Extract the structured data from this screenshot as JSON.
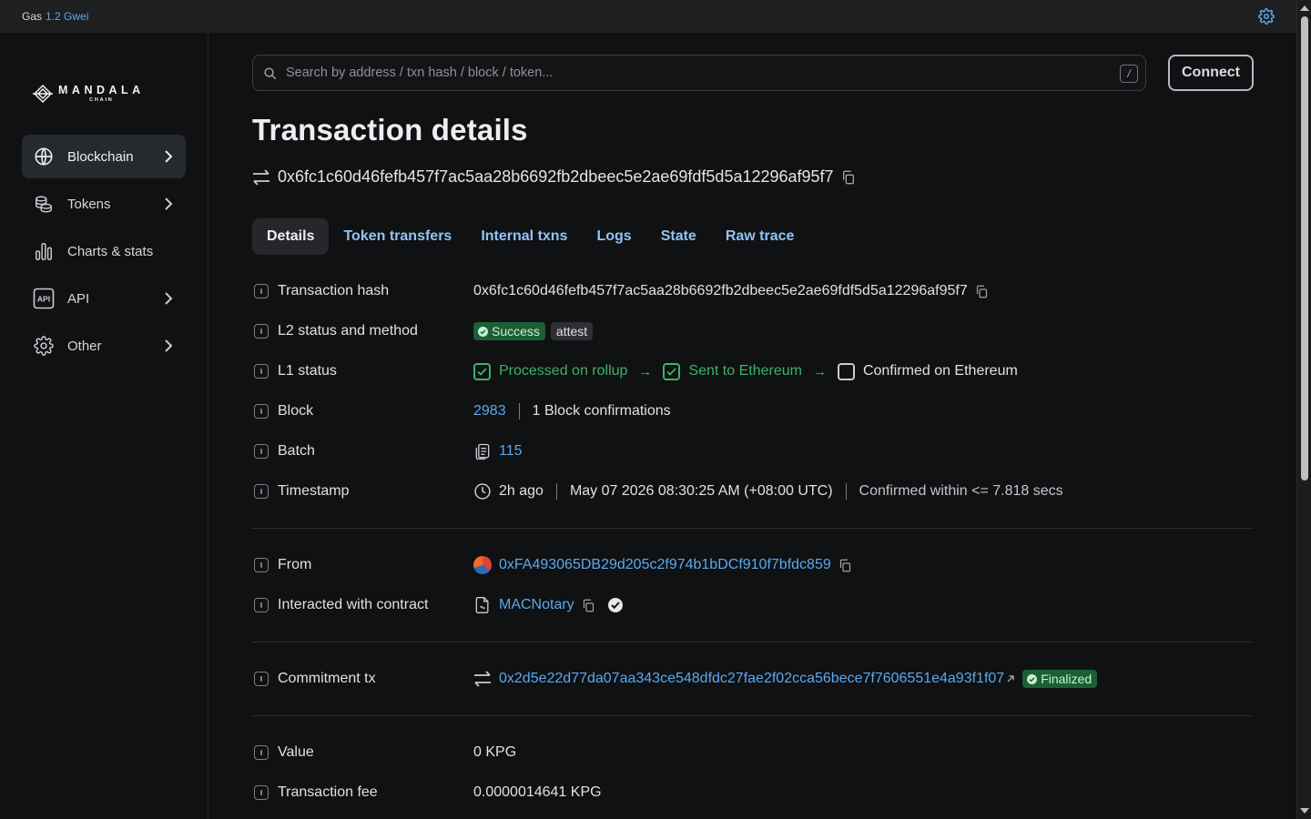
{
  "topbar": {
    "gas_label": "Gas",
    "gas_value": "1.2 Gwei"
  },
  "sidebar": {
    "logo_main": "MANDALA",
    "logo_sub": "CHAIN",
    "items": [
      {
        "label": "Blockchain",
        "icon": "globe-icon",
        "active": true,
        "has_chevron": true
      },
      {
        "label": "Tokens",
        "icon": "coins-icon",
        "active": false,
        "has_chevron": true
      },
      {
        "label": "Charts & stats",
        "icon": "bar-chart-icon",
        "active": false,
        "has_chevron": false
      },
      {
        "label": "API",
        "icon": "api-icon",
        "active": false,
        "has_chevron": true
      },
      {
        "label": "Other",
        "icon": "gear-icon",
        "active": false,
        "has_chevron": true
      }
    ]
  },
  "search": {
    "placeholder": "Search by address / txn hash / block / token...",
    "shortcut": "/"
  },
  "connect_label": "Connect",
  "page_title": "Transaction details",
  "tx_hash": "0x6fc1c60d46fefb457f7ac5aa28b6692fb2dbeec5e2ae69fdf5d5a12296af95f7",
  "tabs": [
    "Details",
    "Token transfers",
    "Internal txns",
    "Logs",
    "State",
    "Raw trace"
  ],
  "details": {
    "hash_label": "Transaction hash",
    "hash_value": "0x6fc1c60d46fefb457f7ac5aa28b6692fb2dbeec5e2ae69fdf5d5a12296af95f7",
    "status_label": "L2 status and method",
    "status_value": "Success",
    "method_value": "attest",
    "l1_label": "L1 status",
    "l1_steps": [
      "Processed on rollup",
      "Sent to Ethereum",
      "Confirmed on Ethereum"
    ],
    "block_label": "Block",
    "block_value": "2983",
    "block_confirmations": "1 Block confirmations",
    "batch_label": "Batch",
    "batch_value": "115",
    "timestamp_label": "Timestamp",
    "timestamp_ago": "2h ago",
    "timestamp_full": "May 07 2026 08:30:25 AM (+08:00 UTC)",
    "timestamp_confirmed": "Confirmed within <= 7.818 secs",
    "from_label": "From",
    "from_value": "0xFA493065DB29d205c2f974b1bDCf910f7bfdc859",
    "contract_label": "Interacted with contract",
    "contract_value": "MACNotary",
    "commitment_label": "Commitment tx",
    "commitment_value": "0x2d5e22d77da07aa343ce548dfdc27fae2f02cca56bece7f7606551e4a93f1f07",
    "commitment_status": "Finalized",
    "value_label": "Value",
    "value_value": "0 KPG",
    "fee_label": "Transaction fee",
    "fee_value": "0.0000014641 KPG"
  }
}
